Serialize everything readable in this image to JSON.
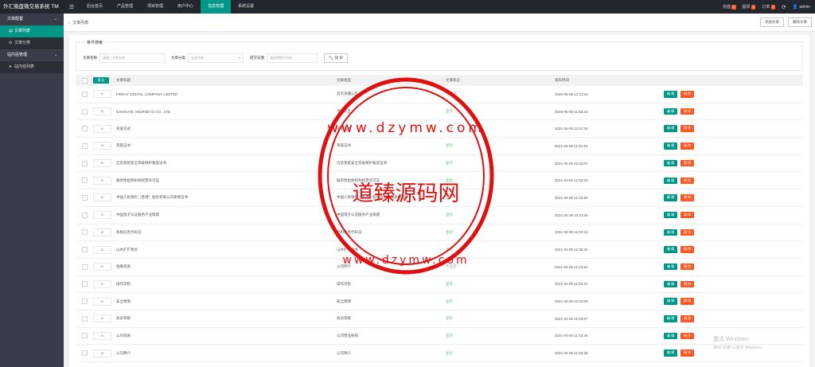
{
  "app": {
    "title": "外汇微盘微交易系统 TM",
    "menu_icon": "hamburger-icon"
  },
  "topnav": [
    "后台首页",
    "产品管理",
    "项目管理",
    "用户中心",
    "信息管理",
    "系统设置"
  ],
  "topnav_active": 4,
  "top_right": {
    "recharge_label": "充值",
    "recharge_count": "0",
    "withdraw_label": "提现",
    "withdraw_count": "0",
    "order_label": "订单",
    "order_count": "0",
    "user": "admin"
  },
  "sidebar": {
    "group1": "文章配置",
    "group1_items": [
      "文章列表",
      "文章分类"
    ],
    "group2": "站内信管理",
    "group2_items": [
      "站内信列表"
    ]
  },
  "tabbar": {
    "current_tab": "文章列表",
    "add_button": "添加文章",
    "delete_button": "删除文章"
  },
  "search": {
    "legend": "条件搜索",
    "name_label": "文章名称",
    "name_placeholder": "请输入文章名称",
    "category_label": "文章分类",
    "category_value": "全部文章",
    "date_label": "提交日期",
    "date_placeholder": "请选择提交时间",
    "button": "搜 索"
  },
  "table": {
    "save_button": "保 存",
    "headers": {
      "title": "文章标题",
      "type": "文章类型",
      "status": "文章状态",
      "time": "发布时间"
    },
    "edit_label": "编 辑",
    "delete_label": "删 除",
    "rows": [
      {
        "sort": "0",
        "title": "FRIDAY DIGITAL COMPANY LIMITED",
        "type": "首页滚播公告",
        "status": "不显示",
        "time": "2025-06-08 12:13:42"
      },
      {
        "sort": "0",
        "title": "NAVIGATE JOURNEYS CO., LTD.",
        "type": "平台公告",
        "status": "显示",
        "time": "2025-06-09 11:56:16"
      },
      {
        "sort": "0",
        "title": "充值方式",
        "type": "充值方式",
        "status": "显示",
        "time": "2021-04-05 11:01:34"
      },
      {
        "sort": "0",
        "title": "荣誉证书",
        "type": "荣誉证书",
        "status": "显示",
        "time": "2021-04-05 11:01:54"
      },
      {
        "sort": "0",
        "title": "信息系统安全等级保护备案证书",
        "type": "信息系统安全等级保护备案证书",
        "status": "显示",
        "time": "2021-04-05 11:02:07"
      },
      {
        "sort": "0",
        "title": "融资性担保机构经营许可证",
        "type": "融资性担保机构经营许可证",
        "status": "显示",
        "time": "2021-04-05 11:02:33"
      },
      {
        "sort": "0",
        "title": "中国人民保险（香港）股份有限公司承保证书",
        "type": "中国人民保险（香港）股份有限公司承保证书",
        "status": "显示",
        "time": "2021-04-05 11:02:50"
      },
      {
        "sort": "0",
        "title": "中国电子认证服务产业联盟",
        "type": "中国电子认证服务产业联盟",
        "status": "显示",
        "time": "2021-02-28 13:22:45"
      },
      {
        "sort": "0",
        "title": "机构信息代码证",
        "type": "机构信息代码证",
        "status": "显示",
        "time": "2021-04-05 11:03:13"
      },
      {
        "sort": "0",
        "title": "山木扩扩税务",
        "type": "山木扩扩税务",
        "status": "显示",
        "time": "2021-04-05 11:05:32"
      },
      {
        "sort": "0",
        "title": "金融资质",
        "type": "公司简介",
        "status": "不显示",
        "time": "2021-04-05 11:04:52"
      },
      {
        "sort": "0",
        "title": "操作流程",
        "type": "操作流程",
        "status": "显示",
        "time": "2021-04-05 11:04:31"
      },
      {
        "sort": "0",
        "title": "安全保障",
        "type": "安全保障",
        "status": "显示",
        "time": "2021-04-05 11:04:09"
      },
      {
        "sort": "0",
        "title": "会员等级",
        "type": "会员等级",
        "status": "显示",
        "time": "2021-04-05 11:03:57"
      },
      {
        "sort": "0",
        "title": "公司资质",
        "type": "公司营业执照",
        "status": "显示",
        "time": "2021-04-05 11:03:44"
      },
      {
        "sort": "0",
        "title": "公司简介",
        "type": "公司简介",
        "status": "显示",
        "time": "2021-04-05 11:03:28"
      }
    ]
  },
  "watermark": {
    "main_text": "道臻源码网",
    "url_top": "www.dzymw.com",
    "url_bottom": "www.dzymw.com",
    "color": "#e01010"
  },
  "os_notice": {
    "line1": "激活 Windows",
    "line2": "转到\"设置\"以激活 Windows。"
  },
  "colors": {
    "accent": "#009688",
    "danger": "#ff5722",
    "dark": "#23262e",
    "sidebar": "#393d49",
    "show_status": "#5fb878"
  }
}
